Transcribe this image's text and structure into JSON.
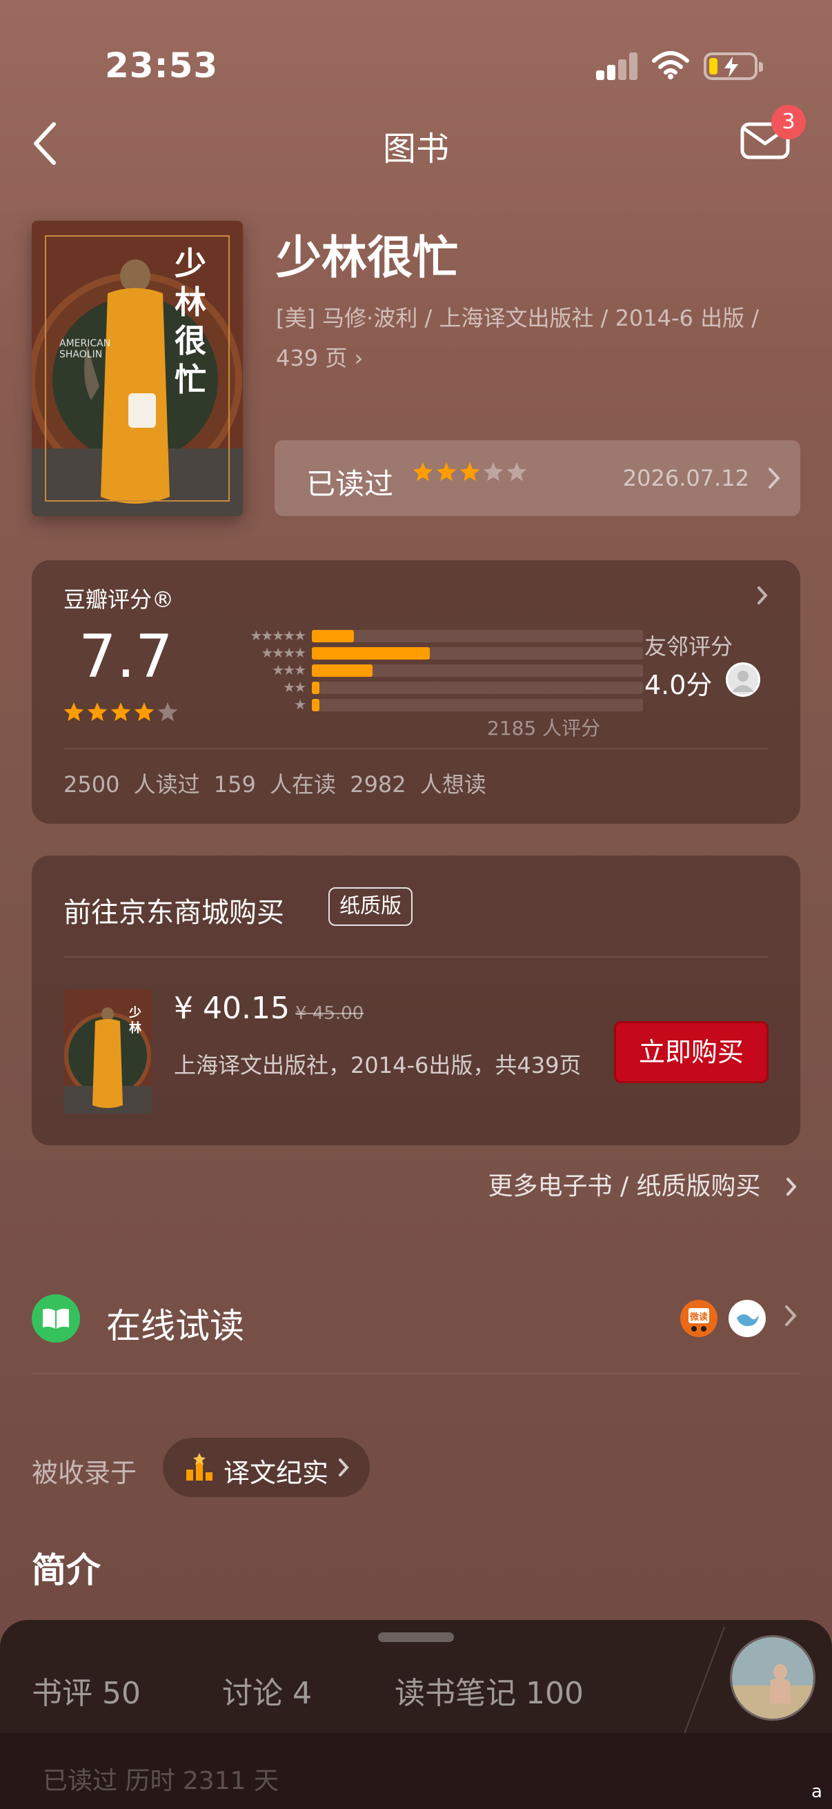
{
  "status_bar": {
    "time": "23:53"
  },
  "nav": {
    "title": "图书",
    "mail_badge": "3"
  },
  "book": {
    "title": "少林很忙",
    "meta": "[美] 马修·波利 / 上海译文出版社 / 2014-6 出版 / 439 页",
    "meta_chevron": "›",
    "cover_title": "少林很忙",
    "cover_subtitle": "AMERICAN SHAOLIN"
  },
  "reading_status": {
    "label": "已读过",
    "stars": 3,
    "date": "2026.07.12"
  },
  "rating": {
    "header": "豆瓣评分®",
    "score": "7.7",
    "stars": 4,
    "distribution": [
      {
        "stars": "★★★★★",
        "fraction": 0.11
      },
      {
        "stars": "★★★★",
        "fraction": 0.31
      },
      {
        "stars": "★★★",
        "fraction": 0.16
      },
      {
        "stars": "★★",
        "fraction": 0.02
      },
      {
        "stars": "★",
        "fraction": 0.02
      }
    ],
    "count": "2185 人评分",
    "friend_label": "友邻评分",
    "friend_score": "4.0分",
    "read_stats": "2500 人读过   159 人在读   2982 人想读"
  },
  "buy": {
    "title": "前往京东商城购买",
    "tag": "纸质版",
    "price": "¥ 40.15",
    "old_price": "¥ 45.00",
    "desc": "上海译文出版社，2014-6出版，共439页",
    "button": "立即购买",
    "more_link": "更多电子书 / 纸质版购买"
  },
  "online_read": {
    "label": "在线试读",
    "source1": "微读"
  },
  "collection": {
    "label": "被收录于",
    "chip": "译文纪实"
  },
  "intro": {
    "title": "简介"
  },
  "bottom_sheet": {
    "tabs": [
      "书评 50",
      "讨论 4",
      "读书笔记 100"
    ],
    "bottom_text": "已读过 历时 2311 天"
  },
  "home_indicator": "a",
  "colors": {
    "accent_orange": "#ff9d00",
    "buy_red": "#c5081a",
    "badge_red": "#f25559",
    "online_green": "#35c25d"
  }
}
